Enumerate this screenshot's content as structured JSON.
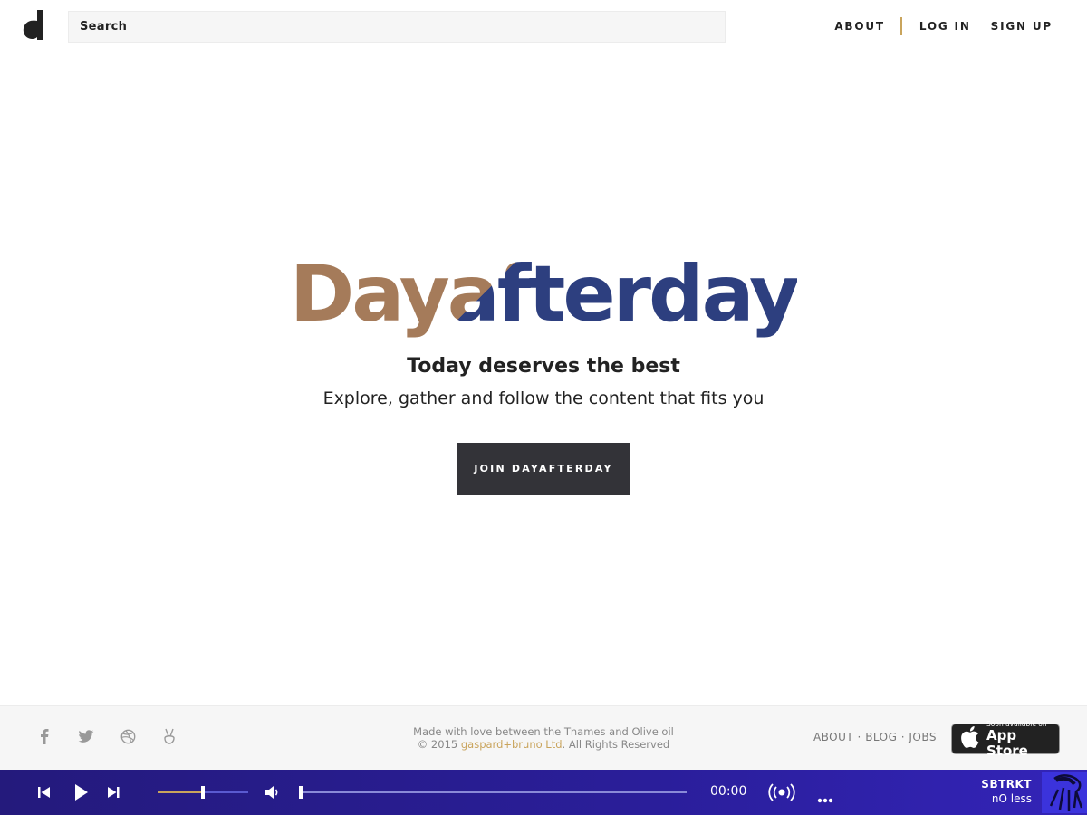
{
  "header": {
    "search_placeholder": "Search",
    "nav": {
      "about": "ABOUT",
      "login": "LOG IN",
      "signup": "SIGN UP"
    },
    "accent": "#c9a45c"
  },
  "hero": {
    "wordmark": "Dayafterday",
    "tagline": "Today deserves the best",
    "subline": "Explore, gather and follow the content that fits you",
    "cta": "JOIN DAYAFTERDAY",
    "wordmark_colors": [
      "#a57b5a",
      "#2d3f7f"
    ]
  },
  "footer": {
    "social_icons": [
      "facebook-icon",
      "twitter-icon",
      "dribbble-icon",
      "angellist-icon"
    ],
    "credit_line1": "Made with love between the Thames and Olive oil",
    "credit_prefix": "© 2015 ",
    "credit_brand": "gaspard+bruno Ltd",
    "credit_suffix": ". All Rights Reserved",
    "links": {
      "about": "ABOUT",
      "blog": "BLOG",
      "jobs": "JOBS",
      "separator": " · "
    },
    "appstore_small": "Soon available on",
    "appstore_big": "App Store"
  },
  "player": {
    "time": "00:00",
    "artist": "SBTRKT",
    "title": "nO less",
    "volume_level": 0.5,
    "progress": 0.0,
    "background": "#241a7c"
  }
}
